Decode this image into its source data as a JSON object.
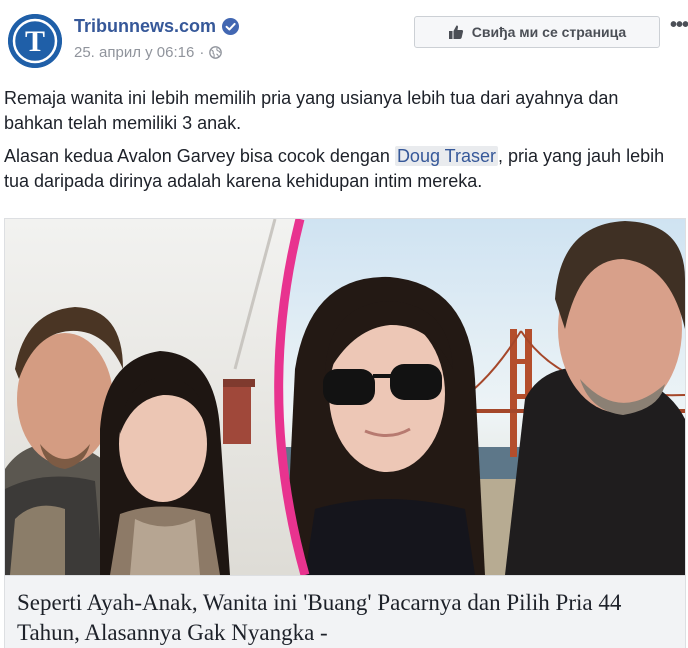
{
  "header": {
    "page_name": "Tribunnews.com",
    "date": "25. април у 06:16",
    "separator": "·",
    "like_button_label": "Свиђа ми се страница",
    "more_label": "•••"
  },
  "post": {
    "paragraph1": "Remaja wanita ini lebih memilih pria yang usianya lebih tua dari ayahnya dan bahkan telah memiliki 3 anak.",
    "paragraph2_before": "Alasan kedua Avalon Garvey bisa cocok dengan ",
    "mention": "Doug Traser",
    "paragraph2_after": ", pria yang jauh lebih tua daripada dirinya adalah karena kehidupan intim mereka."
  },
  "link_card": {
    "title": "Seperti Ayah-Anak, Wanita ini 'Buang' Pacarnya dan Pilih Pria 44 Tahun, Alasannya Gak Nyangka -"
  },
  "icons": {
    "avatar": "tribun-logo-icon",
    "verified": "verified-badge-icon",
    "privacy": "globe-icon",
    "like": "thumbs-up-icon"
  },
  "colors": {
    "link_blue": "#365899",
    "brand_blue": "#1f5fa8",
    "verified_blue": "#4267b2",
    "pink_frame": "#e8338f"
  }
}
